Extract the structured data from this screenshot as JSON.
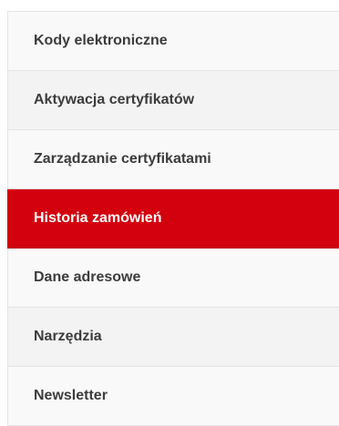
{
  "menu": {
    "items": [
      {
        "label": "Kody elektroniczne",
        "active": false
      },
      {
        "label": "Aktywacja certyfikatów",
        "active": false
      },
      {
        "label": "Zarządzanie certyfikatami",
        "active": false
      },
      {
        "label": "Historia zamówień",
        "active": true
      },
      {
        "label": "Dane adresowe",
        "active": false
      },
      {
        "label": "Narzędzia",
        "active": false
      },
      {
        "label": "Newsletter",
        "active": false
      }
    ]
  },
  "colors": {
    "active_background": "#d3000e",
    "active_text": "#ffffff",
    "item_text": "#3c3c3c",
    "item_background": "#f6f6f6",
    "divider": "#e4e4e4"
  }
}
